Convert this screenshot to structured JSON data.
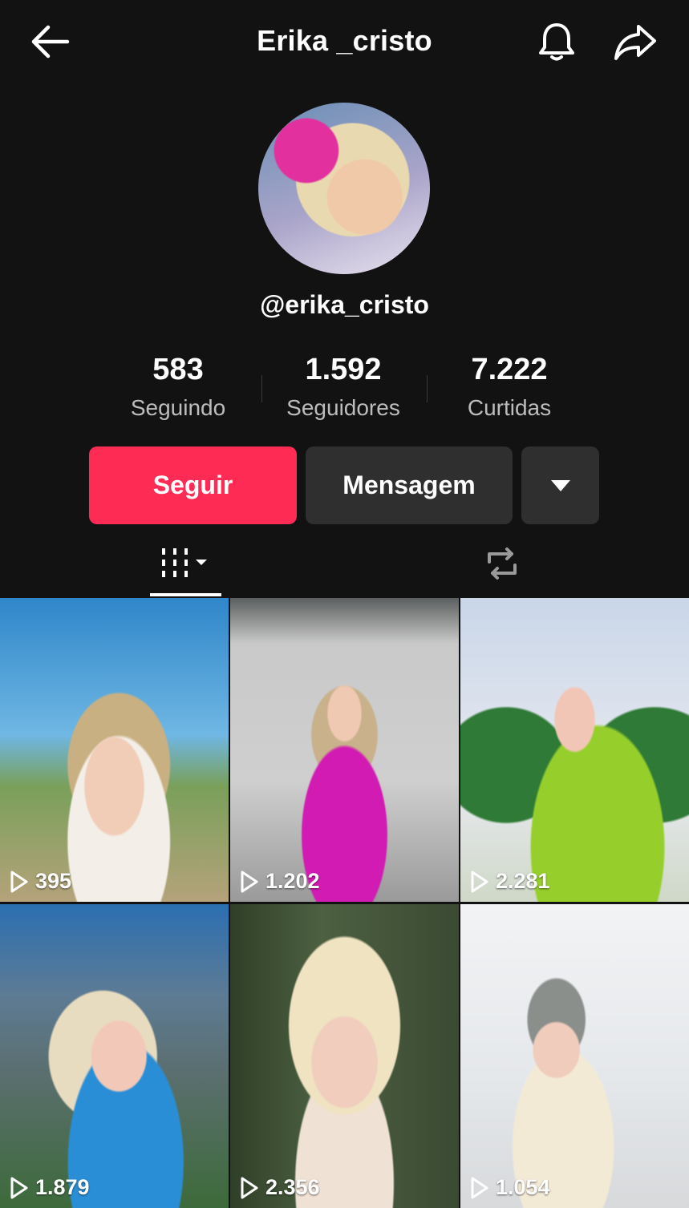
{
  "header": {
    "title": "Erika _cristo",
    "back_icon": "arrow-left-icon",
    "bell_icon": "bell-icon",
    "share_icon": "share-arrow-icon"
  },
  "profile": {
    "handle": "@erika_cristo"
  },
  "stats": [
    {
      "value": "583",
      "label": "Seguindo"
    },
    {
      "value": "1.592",
      "label": "Seguidores"
    },
    {
      "value": "7.222",
      "label": "Curtidas"
    }
  ],
  "actions": {
    "follow_label": "Seguir",
    "message_label": "Mensagem",
    "more_icon": "caret-down-icon"
  },
  "tabs": {
    "videos_icon": "video-grid-icon",
    "repost_icon": "repost-icon"
  },
  "videos": [
    {
      "views": "395"
    },
    {
      "views": "1.202"
    },
    {
      "views": "2.281"
    },
    {
      "views": "1.879"
    },
    {
      "views": "2.356"
    },
    {
      "views": "1.054"
    }
  ],
  "colors": {
    "background": "#121212",
    "follow_button": "#fe2c55",
    "secondary_button": "#2f2f2f",
    "muted_text": "#bdbdbd"
  }
}
